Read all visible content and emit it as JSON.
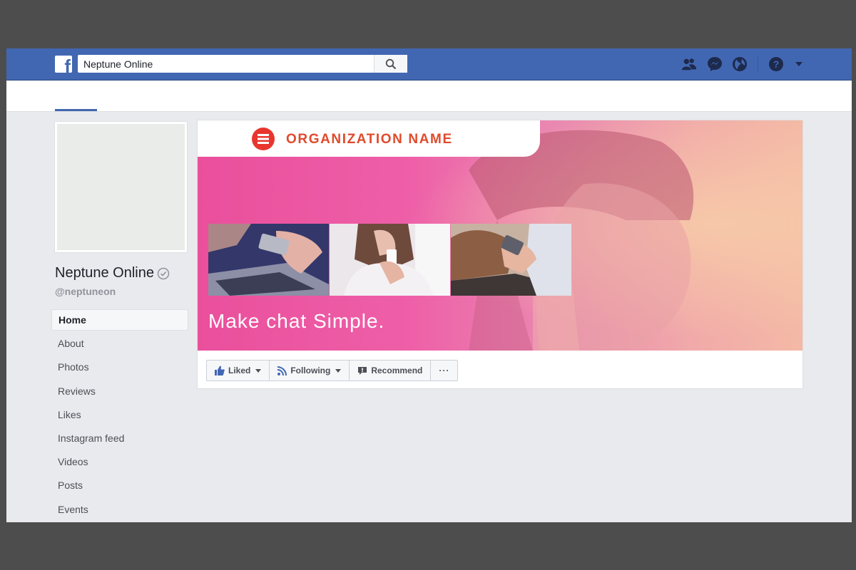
{
  "topbar": {
    "brand_icon": "facebook-f-logo",
    "search_value": "Neptune Online",
    "icons": [
      "friends-icon",
      "messenger-icon",
      "globe-icon",
      "help-icon",
      "dropdown-caret-icon"
    ],
    "bar_color": "#4267b2"
  },
  "profile": {
    "name": "Neptune Online",
    "handle": "@neptuneon",
    "verified_icon": "check-circle-icon"
  },
  "nav": {
    "items": [
      {
        "label": "Home",
        "active": true
      },
      {
        "label": "About"
      },
      {
        "label": "Photos"
      },
      {
        "label": "Reviews"
      },
      {
        "label": "Likes"
      },
      {
        "label": "Instagram feed"
      },
      {
        "label": "Videos"
      },
      {
        "label": "Posts"
      },
      {
        "label": "Events"
      }
    ]
  },
  "cover": {
    "org_name": "ORGANIZATION NAME",
    "tagline": "Make chat Simple.",
    "accent_color": "#e04a2c",
    "gradient_start": "#ea4f9c",
    "photo_thumbnails": [
      "laptop-and-phone-photo",
      "woman-texting-photo",
      "person-with-bag-photo"
    ]
  },
  "actions": {
    "liked": "Liked",
    "following": "Following",
    "recommend": "Recommend",
    "more": "···"
  }
}
